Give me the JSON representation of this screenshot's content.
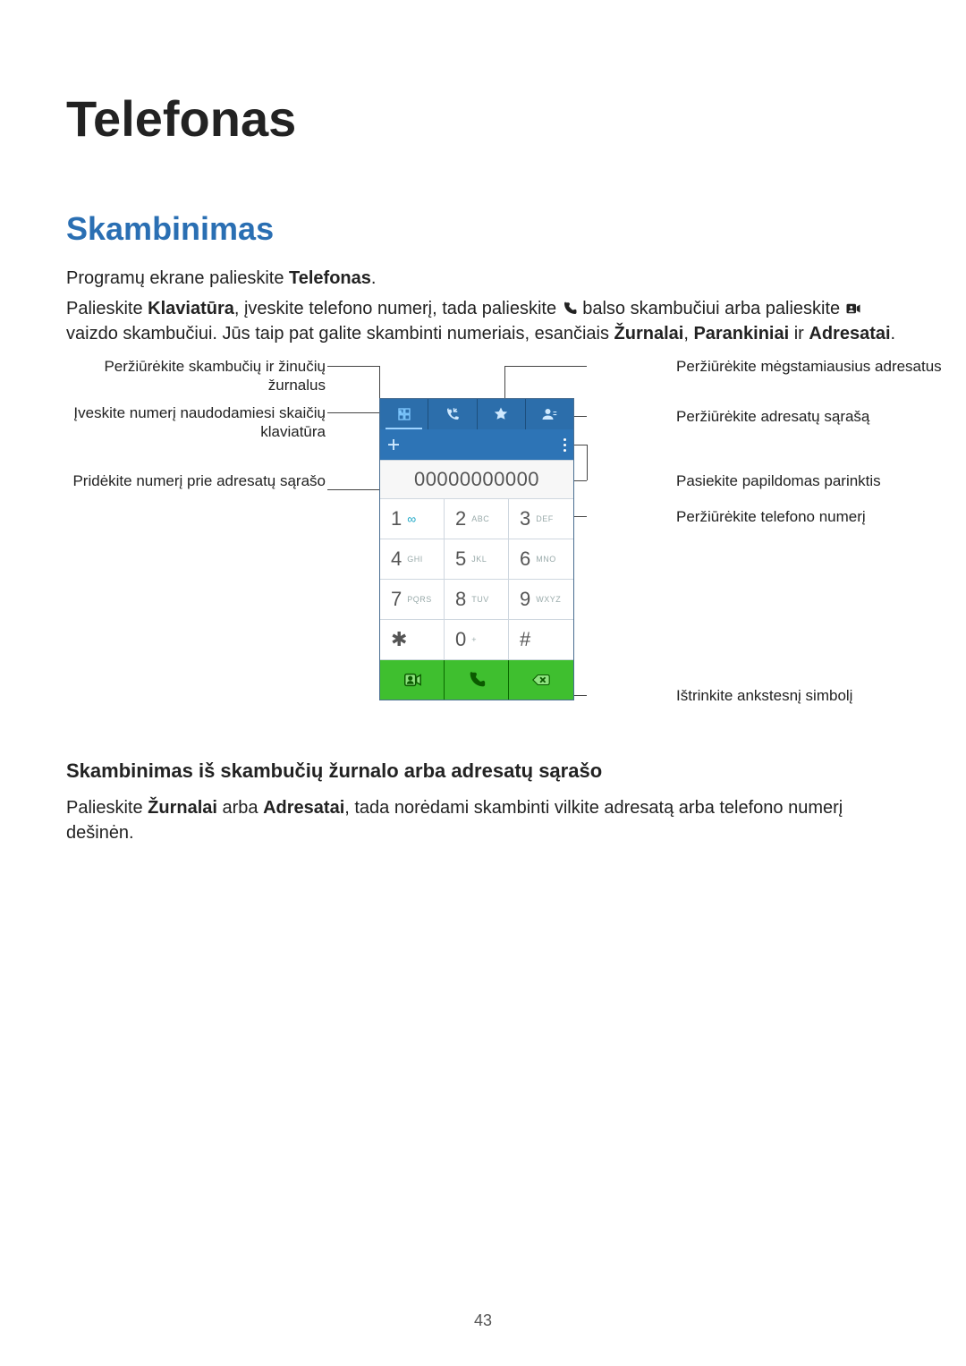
{
  "page_number": "43",
  "title": "Telefonas",
  "section": "Skambinimas",
  "para1_pre": "Programų ekrane palieskite ",
  "para1_bold": "Telefonas",
  "para1_post": ".",
  "para2_a": "Palieskite ",
  "para2_b": "Klaviatūra",
  "para2_c": ", įveskite telefono numerį, tada palieskite ",
  "para2_d": " balso skambučiui arba palieskite ",
  "para2_e": " vaizdo skambučiui. Jūs taip pat galite skambinti numeriais, esančiais ",
  "para2_f": "Žurnalai",
  "para2_g": ", ",
  "para2_h": "Parankiniai",
  "para2_i": " ir ",
  "para2_j": "Adresatai",
  "para2_k": ".",
  "callouts": {
    "left": {
      "logs": "Peržiūrėkite skambučių ir žinučių žurnalus",
      "keypad": "Įveskite numerį naudodamiesi skaičių klaviatūra",
      "add": "Pridėkite numerį prie adresatų sąrašo"
    },
    "right": {
      "fav": "Peržiūrėkite mėgstamiausius adresatus",
      "contacts": "Peržiūrėkite adresatų sąrašą",
      "more": "Pasiekite papildomas parinktis",
      "number": "Peržiūrėkite telefono numerį",
      "backspace": "Ištrinkite ankstesnį simbolį"
    }
  },
  "phone": {
    "number": "00000000000",
    "keys": [
      {
        "d": "1",
        "sub": "",
        "vm": "∞"
      },
      {
        "d": "2",
        "sub": "ABC"
      },
      {
        "d": "3",
        "sub": "DEF"
      },
      {
        "d": "4",
        "sub": "GHI"
      },
      {
        "d": "5",
        "sub": "JKL"
      },
      {
        "d": "6",
        "sub": "MNO"
      },
      {
        "d": "7",
        "sub": "PQRS"
      },
      {
        "d": "8",
        "sub": "TUV"
      },
      {
        "d": "9",
        "sub": "WXYZ"
      },
      {
        "d": "✱",
        "sub": ""
      },
      {
        "d": "0",
        "sub": "+"
      },
      {
        "d": "#",
        "sub": ""
      }
    ]
  },
  "subhead": "Skambinimas iš skambučių žurnalo arba adresatų sąrašo",
  "para3_a": "Palieskite ",
  "para3_b": "Žurnalai",
  "para3_c": " arba ",
  "para3_d": "Adresatai",
  "para3_e": ", tada norėdami skambinti vilkite adresatą arba telefono numerį dešinėn."
}
